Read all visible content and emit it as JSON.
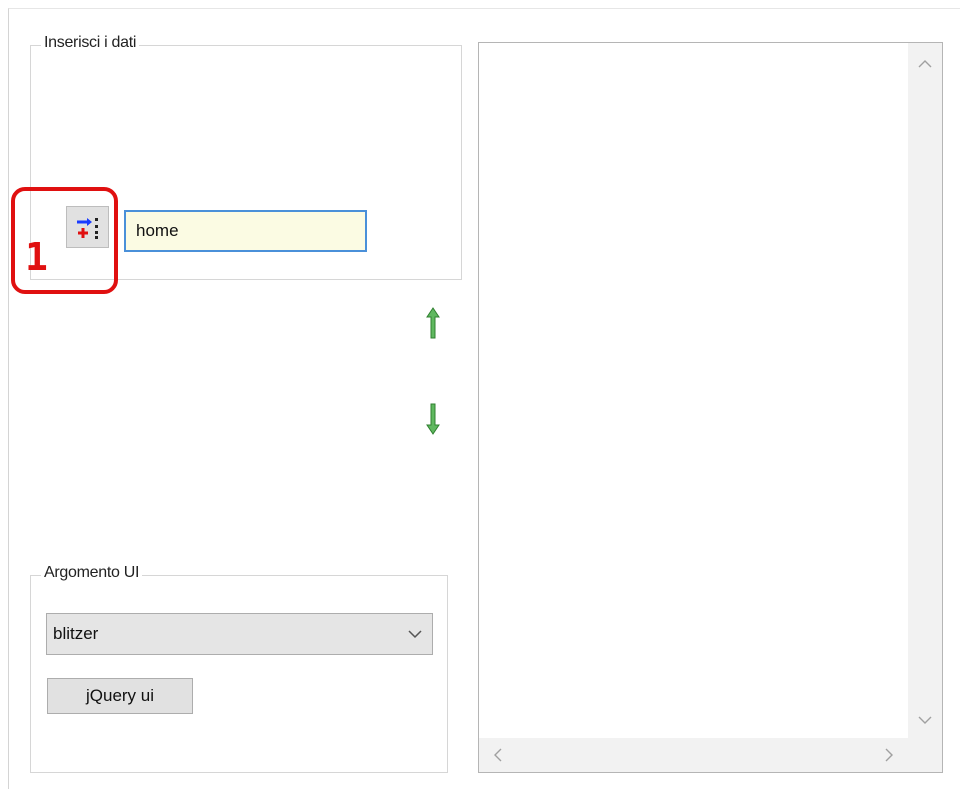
{
  "input_group": {
    "legend": "Inserisci i dati",
    "text_value": "home",
    "add_button_icon": "add-to-list-icon"
  },
  "annotation": {
    "number": "1",
    "color": "#e01010"
  },
  "move_buttons": {
    "up_icon": "arrow-up-icon",
    "down_icon": "arrow-down-icon",
    "color": "#3a9a3a"
  },
  "theme_group": {
    "legend": "Argomento UI",
    "selected": "blitzer",
    "button_label": "jQuery ui"
  },
  "list": {
    "items": []
  }
}
